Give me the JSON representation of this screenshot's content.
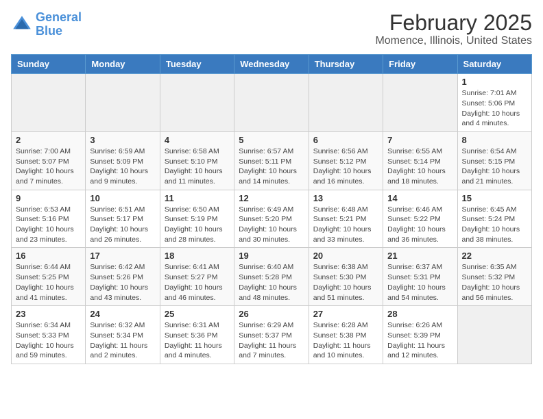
{
  "header": {
    "logo_line1": "General",
    "logo_line2": "Blue",
    "title": "February 2025",
    "subtitle": "Momence, Illinois, United States"
  },
  "weekdays": [
    "Sunday",
    "Monday",
    "Tuesday",
    "Wednesday",
    "Thursday",
    "Friday",
    "Saturday"
  ],
  "weeks": [
    [
      {
        "day": "",
        "info": ""
      },
      {
        "day": "",
        "info": ""
      },
      {
        "day": "",
        "info": ""
      },
      {
        "day": "",
        "info": ""
      },
      {
        "day": "",
        "info": ""
      },
      {
        "day": "",
        "info": ""
      },
      {
        "day": "1",
        "info": "Sunrise: 7:01 AM\nSunset: 5:06 PM\nDaylight: 10 hours and 4 minutes."
      }
    ],
    [
      {
        "day": "2",
        "info": "Sunrise: 7:00 AM\nSunset: 5:07 PM\nDaylight: 10 hours and 7 minutes."
      },
      {
        "day": "3",
        "info": "Sunrise: 6:59 AM\nSunset: 5:09 PM\nDaylight: 10 hours and 9 minutes."
      },
      {
        "day": "4",
        "info": "Sunrise: 6:58 AM\nSunset: 5:10 PM\nDaylight: 10 hours and 11 minutes."
      },
      {
        "day": "5",
        "info": "Sunrise: 6:57 AM\nSunset: 5:11 PM\nDaylight: 10 hours and 14 minutes."
      },
      {
        "day": "6",
        "info": "Sunrise: 6:56 AM\nSunset: 5:12 PM\nDaylight: 10 hours and 16 minutes."
      },
      {
        "day": "7",
        "info": "Sunrise: 6:55 AM\nSunset: 5:14 PM\nDaylight: 10 hours and 18 minutes."
      },
      {
        "day": "8",
        "info": "Sunrise: 6:54 AM\nSunset: 5:15 PM\nDaylight: 10 hours and 21 minutes."
      }
    ],
    [
      {
        "day": "9",
        "info": "Sunrise: 6:53 AM\nSunset: 5:16 PM\nDaylight: 10 hours and 23 minutes."
      },
      {
        "day": "10",
        "info": "Sunrise: 6:51 AM\nSunset: 5:17 PM\nDaylight: 10 hours and 26 minutes."
      },
      {
        "day": "11",
        "info": "Sunrise: 6:50 AM\nSunset: 5:19 PM\nDaylight: 10 hours and 28 minutes."
      },
      {
        "day": "12",
        "info": "Sunrise: 6:49 AM\nSunset: 5:20 PM\nDaylight: 10 hours and 30 minutes."
      },
      {
        "day": "13",
        "info": "Sunrise: 6:48 AM\nSunset: 5:21 PM\nDaylight: 10 hours and 33 minutes."
      },
      {
        "day": "14",
        "info": "Sunrise: 6:46 AM\nSunset: 5:22 PM\nDaylight: 10 hours and 36 minutes."
      },
      {
        "day": "15",
        "info": "Sunrise: 6:45 AM\nSunset: 5:24 PM\nDaylight: 10 hours and 38 minutes."
      }
    ],
    [
      {
        "day": "16",
        "info": "Sunrise: 6:44 AM\nSunset: 5:25 PM\nDaylight: 10 hours and 41 minutes."
      },
      {
        "day": "17",
        "info": "Sunrise: 6:42 AM\nSunset: 5:26 PM\nDaylight: 10 hours and 43 minutes."
      },
      {
        "day": "18",
        "info": "Sunrise: 6:41 AM\nSunset: 5:27 PM\nDaylight: 10 hours and 46 minutes."
      },
      {
        "day": "19",
        "info": "Sunrise: 6:40 AM\nSunset: 5:28 PM\nDaylight: 10 hours and 48 minutes."
      },
      {
        "day": "20",
        "info": "Sunrise: 6:38 AM\nSunset: 5:30 PM\nDaylight: 10 hours and 51 minutes."
      },
      {
        "day": "21",
        "info": "Sunrise: 6:37 AM\nSunset: 5:31 PM\nDaylight: 10 hours and 54 minutes."
      },
      {
        "day": "22",
        "info": "Sunrise: 6:35 AM\nSunset: 5:32 PM\nDaylight: 10 hours and 56 minutes."
      }
    ],
    [
      {
        "day": "23",
        "info": "Sunrise: 6:34 AM\nSunset: 5:33 PM\nDaylight: 10 hours and 59 minutes."
      },
      {
        "day": "24",
        "info": "Sunrise: 6:32 AM\nSunset: 5:34 PM\nDaylight: 11 hours and 2 minutes."
      },
      {
        "day": "25",
        "info": "Sunrise: 6:31 AM\nSunset: 5:36 PM\nDaylight: 11 hours and 4 minutes."
      },
      {
        "day": "26",
        "info": "Sunrise: 6:29 AM\nSunset: 5:37 PM\nDaylight: 11 hours and 7 minutes."
      },
      {
        "day": "27",
        "info": "Sunrise: 6:28 AM\nSunset: 5:38 PM\nDaylight: 11 hours and 10 minutes."
      },
      {
        "day": "28",
        "info": "Sunrise: 6:26 AM\nSunset: 5:39 PM\nDaylight: 11 hours and 12 minutes."
      },
      {
        "day": "",
        "info": ""
      }
    ]
  ]
}
